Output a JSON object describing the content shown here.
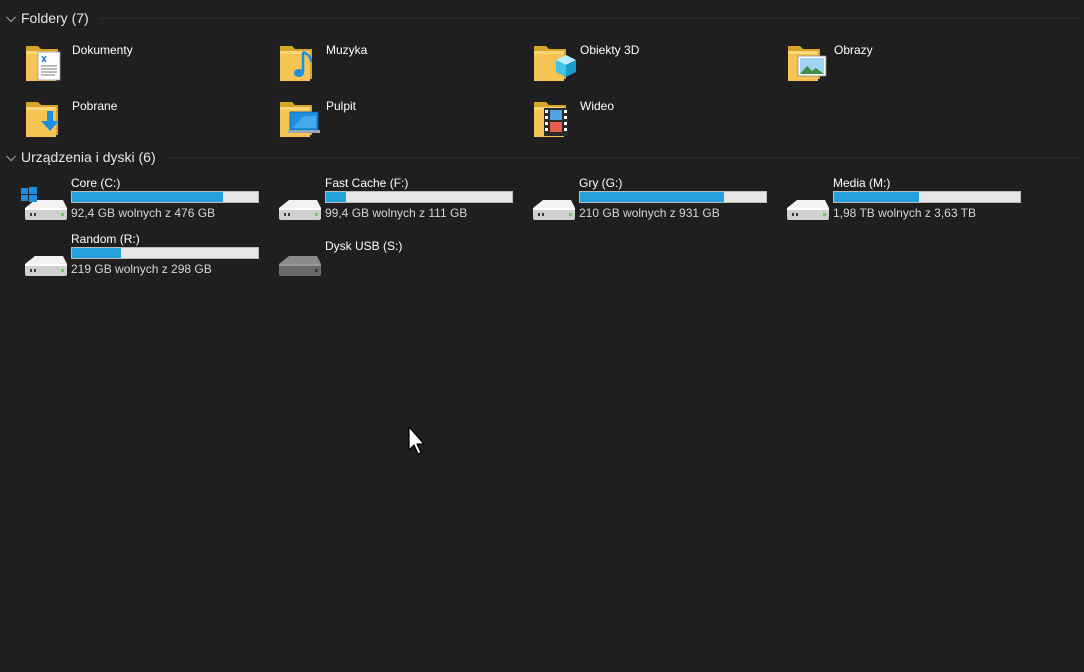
{
  "groups": {
    "folders": {
      "title": "Foldery (7)"
    },
    "drives": {
      "title": "Urządzenia i dyski (6)"
    }
  },
  "folders": [
    {
      "label": "Dokumenty",
      "icon": "documents-folder-icon"
    },
    {
      "label": "Muzyka",
      "icon": "music-folder-icon"
    },
    {
      "label": "Obiekty 3D",
      "icon": "3d-objects-folder-icon"
    },
    {
      "label": "Obrazy",
      "icon": "pictures-folder-icon"
    },
    {
      "label": "Pobrane",
      "icon": "downloads-folder-icon"
    },
    {
      "label": "Pulpit",
      "icon": "desktop-folder-icon"
    },
    {
      "label": "Wideo",
      "icon": "videos-folder-icon"
    }
  ],
  "drives": [
    {
      "name": "Core (C:)",
      "free_text": "92,4 GB wolnych z 476 GB",
      "used_fraction": 0.81,
      "icon": "system-drive-icon"
    },
    {
      "name": "Fast Cache (F:)",
      "free_text": "99,4 GB wolnych z 111 GB",
      "used_fraction": 0.105,
      "icon": "hard-drive-icon"
    },
    {
      "name": "Gry (G:)",
      "free_text": "210 GB wolnych z 931 GB",
      "used_fraction": 0.775,
      "icon": "hard-drive-icon"
    },
    {
      "name": "Media (M:)",
      "free_text": "1,98 TB wolnych z 3,63 TB",
      "used_fraction": 0.455,
      "icon": "hard-drive-icon"
    },
    {
      "name": "Random (R:)",
      "free_text": "219 GB wolnych z 298 GB",
      "used_fraction": 0.265,
      "icon": "hard-drive-icon"
    },
    {
      "name": "Dysk USB (S:)",
      "icon": "usb-drive-icon"
    }
  ],
  "colors": {
    "background": "#1f1f1f",
    "bar_fill": "#26a0da",
    "bar_track": "#e6e6e6",
    "folder_yellow": "#f5c453"
  }
}
